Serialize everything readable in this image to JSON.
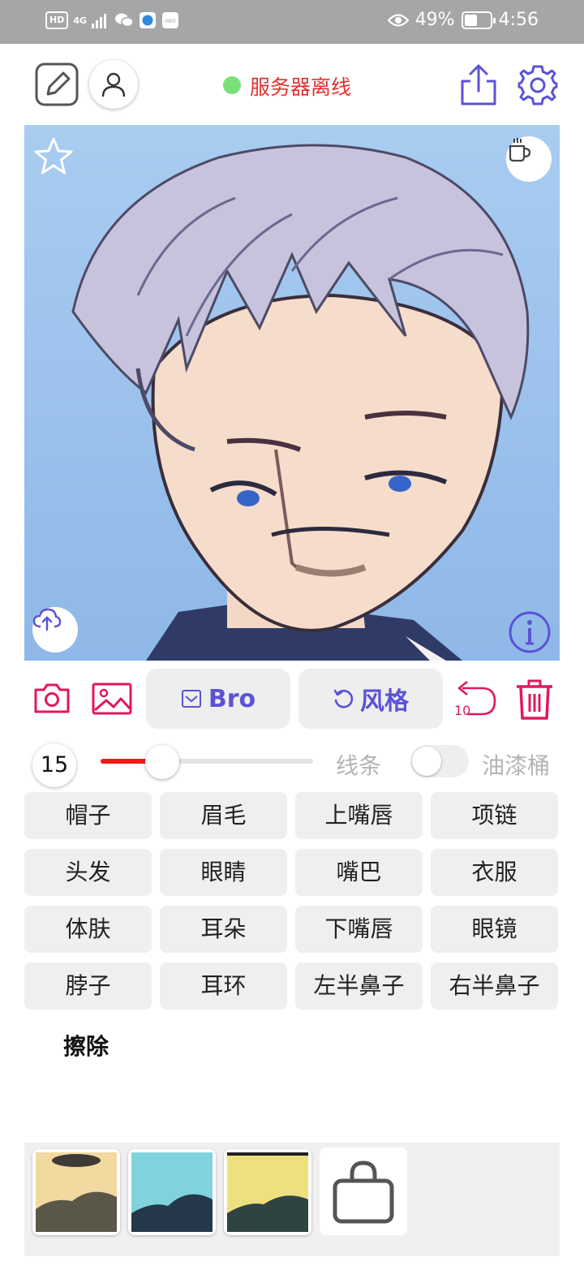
{
  "status_bar": {
    "left_chips": [
      "HD",
      "4G"
    ],
    "battery_text": "49%",
    "battery_level": 0.49,
    "time": "4:56"
  },
  "header": {
    "server_status": "服务器离线",
    "server_status_color": "#e03131",
    "dot_color": "#7ce07a"
  },
  "toolbar": {
    "model_label": "Bro",
    "style_label": "风格",
    "undo_count": "10",
    "accent_color": "#5b52d6",
    "danger_color": "#e0195a"
  },
  "controls": {
    "brush_size": "15",
    "slider_fraction": 0.29,
    "line_label": "线条",
    "paint_bucket_label": "油漆桶",
    "paint_bucket_on": false
  },
  "parts": [
    "帽子",
    "眉毛",
    "上嘴唇",
    "项链",
    "头发",
    "眼睛",
    "嘴巴",
    "衣服",
    "体肤",
    "耳朵",
    "下嘴唇",
    "眼镜",
    "脖子",
    "耳环",
    "左半鼻子",
    "右半鼻子"
  ],
  "erase_label": "擦除"
}
